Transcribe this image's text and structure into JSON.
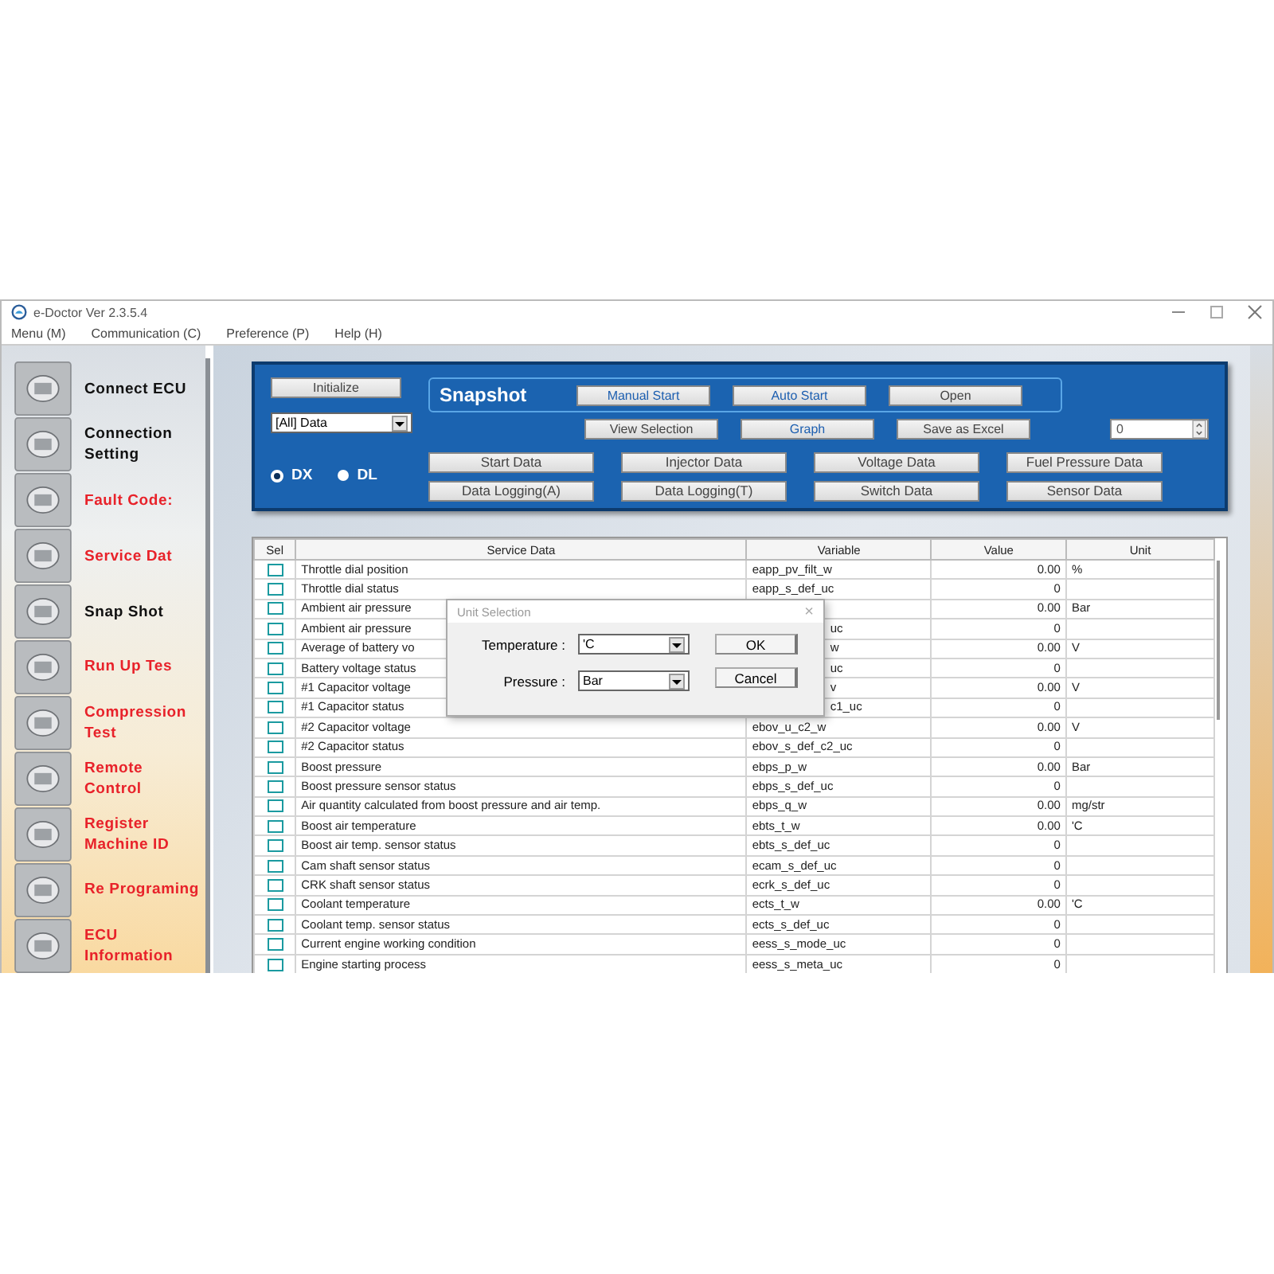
{
  "window": {
    "title": "e-Doctor Ver 2.3.5.4"
  },
  "menu": [
    "Menu (M)",
    "Communication (C)",
    "Preference (P)",
    "Help (H)"
  ],
  "sidebar": {
    "items": [
      {
        "label": "Connect ECU",
        "color": "#111111"
      },
      {
        "label": "Connection Setting",
        "color": "#111111"
      },
      {
        "label": "Fault Code:",
        "color": "#e8222a"
      },
      {
        "label": "Service Dat",
        "color": "#e8222a"
      },
      {
        "label": "Snap Shot",
        "color": "#111111"
      },
      {
        "label": "Run Up Tes",
        "color": "#e8222a"
      },
      {
        "label": "Compression Test",
        "color": "#e8222a"
      },
      {
        "label": "Remote Control",
        "color": "#e8222a"
      },
      {
        "label": "Register Machine ID",
        "color": "#e8222a"
      },
      {
        "label": "Re Programing",
        "color": "#e8222a"
      },
      {
        "label": "ECU Information",
        "color": "#e8222a"
      }
    ]
  },
  "panel": {
    "initialize": "Initialize",
    "filter": "[All] Data",
    "radios": [
      {
        "label": "DX",
        "selected": true
      },
      {
        "label": "DL",
        "selected": false
      }
    ],
    "snapshot": {
      "title": "Snapshot",
      "buttons": [
        {
          "label": "Manual Start",
          "accent": true
        },
        {
          "label": "Auto Start",
          "accent": true
        },
        {
          "label": "Open",
          "accent": false
        },
        {
          "label": "View Selection",
          "accent": false
        },
        {
          "label": "Graph",
          "accent": true
        },
        {
          "label": "Save as Excel",
          "accent": false
        }
      ]
    },
    "spin_value": "0",
    "data_buttons": [
      "Start Data",
      "Injector Data",
      "Voltage Data",
      "Fuel Pressure Data",
      "Data Logging(A)",
      "Data Logging(T)",
      "Switch Data",
      "Sensor Data"
    ]
  },
  "table": {
    "columns": [
      "Sel",
      "Service Data",
      "Variable",
      "Value",
      "Unit"
    ],
    "rows": [
      {
        "checked": false,
        "name": "Throttle dial position",
        "variable": "eapp_pv_filt_w",
        "value": "0.00",
        "unit": "%"
      },
      {
        "checked": false,
        "name": "Throttle dial status",
        "variable": "eapp_s_def_uc",
        "value": "0"
      },
      {
        "checked": false,
        "name": "Ambient air pressure",
        "value": "0.00",
        "unit": "Bar"
      },
      {
        "checked": false,
        "name": "Ambient air pressure",
        "variable": "uc",
        "variable_cut": true,
        "value": "0"
      },
      {
        "checked": false,
        "name": "Average of battery vo",
        "variable": "w",
        "variable_cut": true,
        "value": "0.00",
        "unit": "V"
      },
      {
        "checked": false,
        "name": "Battery voltage status",
        "variable": "uc",
        "variable_cut": true,
        "value": "0"
      },
      {
        "checked": false,
        "name": "#1 Capacitor voltage",
        "variable": "v",
        "variable_cut": true,
        "value": "0.00",
        "unit": "V"
      },
      {
        "checked": false,
        "name": "#1 Capacitor status",
        "variable": "c1_uc",
        "variable_cut": true,
        "value": "0"
      },
      {
        "checked": false,
        "name": "#2 Capacitor voltage",
        "variable": "ebov_u_c2_w",
        "value": "0.00",
        "unit": "V"
      },
      {
        "checked": false,
        "name": "#2 Capacitor status",
        "variable": "ebov_s_def_c2_uc",
        "value": "0"
      },
      {
        "checked": false,
        "name": "Boost pressure",
        "variable": "ebps_p_w",
        "value": "0.00",
        "unit": "Bar"
      },
      {
        "checked": false,
        "name": "Boost pressure sensor status",
        "variable": "ebps_s_def_uc",
        "value": "0"
      },
      {
        "checked": false,
        "name": "Air quantity calculated from boost pressure and air temp.",
        "variable": "ebps_q_w",
        "value": "0.00",
        "unit": "mg/str"
      },
      {
        "checked": false,
        "name": "Boost air temperature",
        "variable": "ebts_t_w",
        "value": "0.00",
        "unit": "'C"
      },
      {
        "checked": false,
        "name": "Boost air temp. sensor status",
        "variable": "ebts_s_def_uc",
        "value": "0"
      },
      {
        "checked": false,
        "name": "Cam shaft sensor status",
        "variable": "ecam_s_def_uc",
        "value": "0"
      },
      {
        "checked": false,
        "name": "CRK shaft sensor status",
        "variable": "ecrk_s_def_uc",
        "value": "0"
      },
      {
        "checked": false,
        "name": "Coolant temperature",
        "variable": "ects_t_w",
        "value": "0.00",
        "unit": "'C"
      },
      {
        "checked": false,
        "name": "Coolant temp. sensor status",
        "variable": "ects_s_def_uc",
        "value": "0"
      },
      {
        "checked": false,
        "name": "Current engine working condition",
        "variable": "eess_s_mode_uc",
        "value": "0"
      },
      {
        "checked": false,
        "name": "Engine starting process",
        "variable": "eess_s_meta_uc",
        "value": "0"
      }
    ]
  },
  "dialog": {
    "title": "Unit Selection",
    "close": "×",
    "fields": [
      {
        "label": "Temperature :",
        "value": "'C"
      },
      {
        "label": "Pressure :",
        "value": "Bar"
      }
    ],
    "buttons": [
      "OK",
      "Cancel"
    ]
  }
}
